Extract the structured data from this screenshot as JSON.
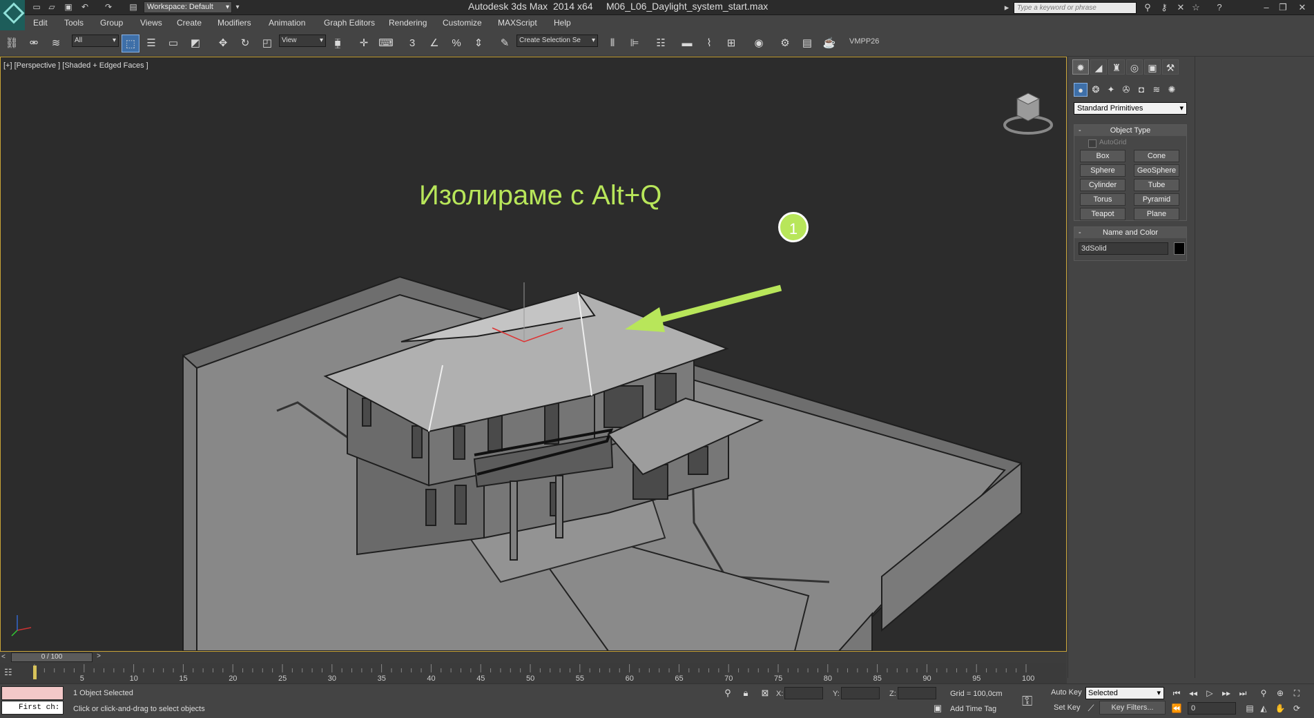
{
  "title_bar": {
    "app_title": "Autodesk 3ds Max  2014 x64     M06_L06_Daylight_system_start.max",
    "workspace": "Workspace: Default",
    "search_placeholder": "Type a keyword or phrase"
  },
  "menu": [
    "Edit",
    "Tools",
    "Group",
    "Views",
    "Create",
    "Modifiers",
    "Animation",
    "Graph Editors",
    "Rendering",
    "Customize",
    "MAXScript",
    "Help"
  ],
  "toolbar": {
    "selection_filter": "All",
    "reference_coord": "View",
    "named_selection": "Create Selection Se",
    "snap_label": "3",
    "vmpp_label": "VMPP26"
  },
  "viewport": {
    "label": "[+] [Perspective ] [Shaded + Edged Faces ]",
    "annotation": "Изолираме с Alt+Q",
    "callout_number": "1",
    "annotation_color": "#b8e65a"
  },
  "command_panel": {
    "primitive_type": "Standard Primitives",
    "object_type_header": "Object Type",
    "autogrid_label": "AutoGrid",
    "buttons": [
      "Box",
      "Cone",
      "Sphere",
      "GeoSphere",
      "Cylinder",
      "Tube",
      "Torus",
      "Pyramid",
      "Teapot",
      "Plane"
    ],
    "name_color_header": "Name and Color",
    "object_name": "3dSolid",
    "object_color": "#000000"
  },
  "timeline": {
    "slider_text": "0 / 100",
    "ticks": [
      "5",
      "10",
      "15",
      "20",
      "25",
      "30",
      "35",
      "40",
      "45",
      "50",
      "55",
      "60",
      "65",
      "70",
      "75",
      "80",
      "85",
      "90",
      "95",
      "100"
    ]
  },
  "status": {
    "maxscript_text": "First ch:",
    "selection_status": "1 Object Selected",
    "prompt": "Click or click-and-drag to select objects",
    "x_label": "X:",
    "y_label": "Y:",
    "z_label": "Z:",
    "grid": "Grid = 100,0cm",
    "add_time_tag": "Add Time Tag",
    "auto_key": "Auto Key",
    "set_key": "Set Key",
    "key_mode": "Selected",
    "key_filters": "Key Filters...",
    "current_frame": "0"
  }
}
